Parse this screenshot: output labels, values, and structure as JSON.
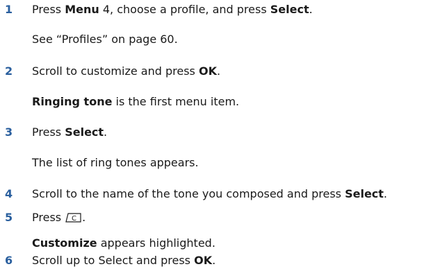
{
  "steps": [
    {
      "number": "1",
      "parts": [
        "Press ",
        "Menu",
        " 4, choose a profile, and press ",
        "Select",
        "."
      ],
      "note": "See “Profiles” on page 60."
    },
    {
      "number": "2",
      "parts": [
        "Scroll to customize and press ",
        "OK",
        "."
      ],
      "note_parts": [
        "Ringing tone",
        " is the first menu item."
      ]
    },
    {
      "number": "3",
      "parts": [
        "Press ",
        "Select",
        "."
      ],
      "note": "The list of ring tones appears."
    },
    {
      "number": "4",
      "parts": [
        "Scroll to the name of the tone you composed and press ",
        "Select",
        "."
      ]
    },
    {
      "number": "5",
      "parts": [
        "Press",
        "."
      ],
      "key_icon_label": "C",
      "note_parts": [
        "Customize",
        " appears highlighted."
      ]
    },
    {
      "number": "6",
      "parts": [
        "Scroll up to Select and press ",
        "OK",
        "."
      ]
    }
  ],
  "colors": {
    "step_number": "#2a5f9e",
    "text": "#1a1a1a"
  }
}
